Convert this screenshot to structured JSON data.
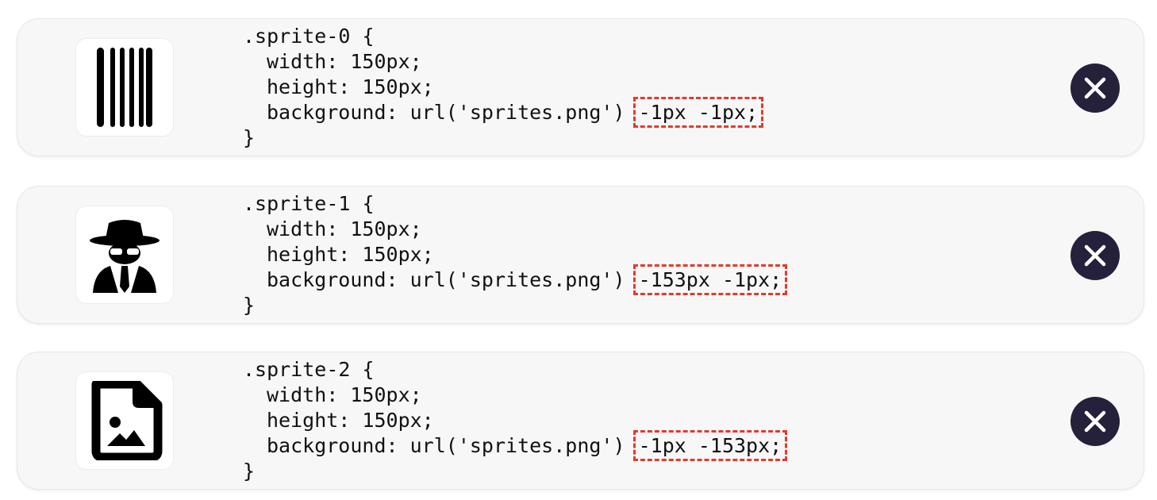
{
  "sprites": [
    {
      "icon": "barcode-icon",
      "selector": ".sprite-0 {",
      "width_line": "width: 150px;",
      "height_line": "height: 150px;",
      "bg_prefix": "background: url('sprites.png') ",
      "bg_position": "-1px -1px;",
      "close": "}"
    },
    {
      "icon": "user-secret-icon",
      "selector": ".sprite-1 {",
      "width_line": "width: 150px;",
      "height_line": "height: 150px;",
      "bg_prefix": "background: url('sprites.png') ",
      "bg_position": "-153px -1px;",
      "close": "}"
    },
    {
      "icon": "file-image-icon",
      "selector": ".sprite-2 {",
      "width_line": "width: 150px;",
      "height_line": "height: 150px;",
      "bg_prefix": "background: url('sprites.png') ",
      "bg_position": "-1px -153px;",
      "close": "}"
    }
  ],
  "colors": {
    "card_background": "#f7f7f7",
    "remove_button": "#25213b",
    "highlight_dash": "#e23a2e"
  }
}
